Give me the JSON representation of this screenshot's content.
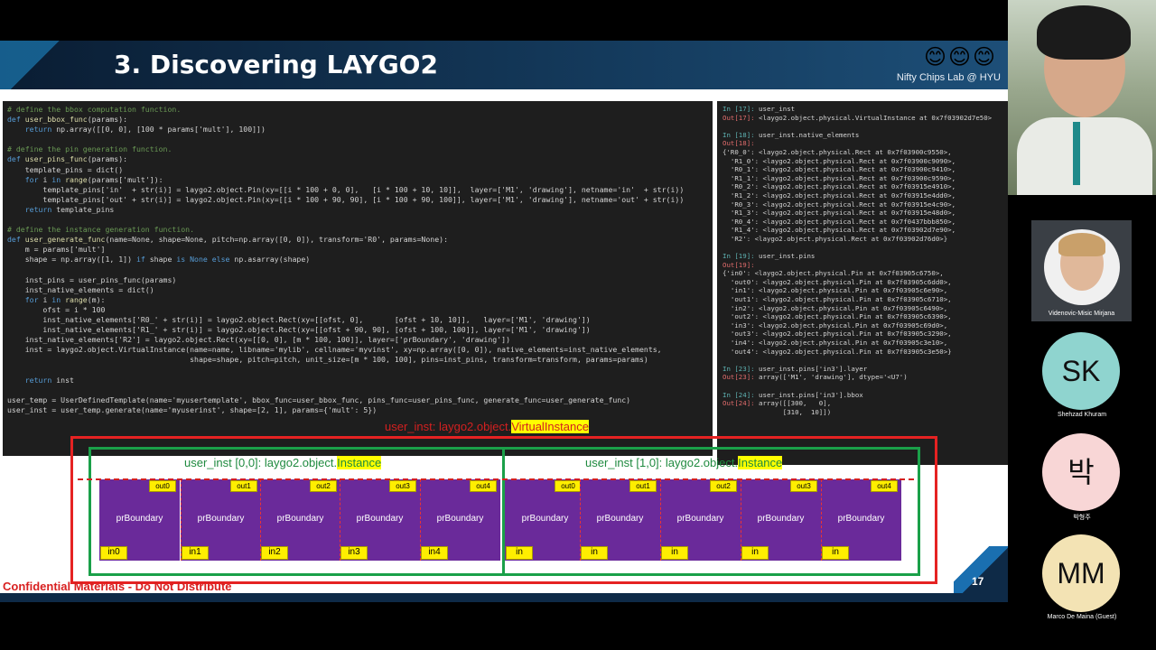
{
  "slide": {
    "title": "3. Discovering LAYGO2",
    "emojis": "😊😊😊",
    "lab_name": "Nifty Chips Lab @ HYU",
    "page_number": "17",
    "confidential": "Confidential Materials - Do Not Distribute"
  },
  "code_left": [
    [
      [
        "cm",
        "# define the bbox computation function."
      ]
    ],
    [
      [
        "kw",
        "def "
      ],
      [
        "fn",
        "user_bbox_func"
      ],
      [
        "",
        "(params):"
      ]
    ],
    [
      [
        "",
        "    "
      ],
      [
        "kw",
        "return "
      ],
      [
        "",
        "np.array([[0, 0], [100 * params['mult'], 100]])"
      ]
    ],
    [
      [
        "",
        ""
      ]
    ],
    [
      [
        "cm",
        "# define the pin generation function."
      ]
    ],
    [
      [
        "kw",
        "def "
      ],
      [
        "fn",
        "user_pins_func"
      ],
      [
        "",
        "(params):"
      ]
    ],
    [
      [
        "",
        "    template_pins = dict()"
      ]
    ],
    [
      [
        "",
        "    "
      ],
      [
        "kw",
        "for "
      ],
      [
        "",
        "i "
      ],
      [
        "kw",
        "in "
      ],
      [
        "fn",
        "range"
      ],
      [
        "",
        "(params['mult']):"
      ]
    ],
    [
      [
        "",
        "        template_pins['in'  + str(i)] = laygo2.object.Pin(xy=[[i * 100 + 0, 0],   [i * 100 + 10, 10]],  layer=['M1', 'drawing'], netname='in'  + str(i))"
      ]
    ],
    [
      [
        "",
        "        template_pins['out' + str(i)] = laygo2.object.Pin(xy=[[i * 100 + 90, 90], [i * 100 + 90, 100]], layer=['M1', 'drawing'], netname='out' + str(i))"
      ]
    ],
    [
      [
        "",
        "    "
      ],
      [
        "kw",
        "return "
      ],
      [
        "",
        "template_pins"
      ]
    ],
    [
      [
        "",
        ""
      ]
    ],
    [
      [
        "cm",
        "# define the instance generation function."
      ]
    ],
    [
      [
        "kw",
        "def "
      ],
      [
        "fn",
        "user_generate_func"
      ],
      [
        "",
        "(name=None, shape=None, pitch=np.array([0, 0]), transform='R0', params=None):"
      ]
    ],
    [
      [
        "",
        "    m = params['mult']"
      ]
    ],
    [
      [
        "",
        "    shape = np.array([1, 1]) "
      ],
      [
        "kw",
        "if "
      ],
      [
        "",
        "shape "
      ],
      [
        "kw",
        "is None else "
      ],
      [
        "",
        "np.asarray(shape)"
      ]
    ],
    [
      [
        "",
        ""
      ]
    ],
    [
      [
        "",
        "    inst_pins = user_pins_func(params)"
      ]
    ],
    [
      [
        "",
        "    inst_native_elements = dict()"
      ]
    ],
    [
      [
        "",
        "    "
      ],
      [
        "kw",
        "for "
      ],
      [
        "",
        "i "
      ],
      [
        "kw",
        "in "
      ],
      [
        "fn",
        "range"
      ],
      [
        "",
        "(m):"
      ]
    ],
    [
      [
        "",
        "        ofst = i * 100"
      ]
    ],
    [
      [
        "",
        "        inst_native_elements['R0_' + str(i)] = laygo2.object.Rect(xy=[[ofst, 0],       [ofst + 10, 10]],   layer=['M1', 'drawing'])"
      ]
    ],
    [
      [
        "",
        "        inst_native_elements['R1_' + str(i)] = laygo2.object.Rect(xy=[[ofst + 90, 90], [ofst + 100, 100]], layer=['M1', 'drawing'])"
      ]
    ],
    [
      [
        "",
        "    inst_native_elements['R2'] = laygo2.object.Rect(xy=[[0, 0], [m * 100, 100]], layer=['prBoundary', 'drawing'])"
      ]
    ],
    [
      [
        "",
        "    inst = laygo2.object.VirtualInstance(name=name, libname='mylib', cellname='myvinst', xy=np.array([0, 0]), native_elements=inst_native_elements,"
      ]
    ],
    [
      [
        "",
        "                                         shape=shape, pitch=pitch, unit_size=[m * 100, 100], pins=inst_pins, transform=transform, params=params)"
      ]
    ],
    [
      [
        "",
        ""
      ]
    ],
    [
      [
        "",
        "    "
      ],
      [
        "kw",
        "return "
      ],
      [
        "",
        "inst"
      ]
    ],
    [
      [
        "",
        ""
      ]
    ],
    [
      [
        "",
        "user_temp = UserDefinedTemplate(name='myusertemplate', bbox_func=user_bbox_func, pins_func=user_pins_func, generate_func=user_generate_func)"
      ]
    ],
    [
      [
        "",
        "user_inst = user_temp.generate(name='myuserinst', shape=[2, 1], params={'mult': 5})"
      ]
    ]
  ],
  "code_right": [
    [
      [
        "pin",
        "In [17]: "
      ],
      [
        "",
        "user_inst"
      ]
    ],
    [
      [
        "outp",
        "Out[17]: "
      ],
      [
        "",
        "<laygo2.object.physical.VirtualInstance at 0x7f03902d7e50>"
      ]
    ],
    [
      [
        "",
        ""
      ]
    ],
    [
      [
        "pin",
        "In [18]: "
      ],
      [
        "",
        "user_inst.native_elements"
      ]
    ],
    [
      [
        "outp",
        "Out[18]:"
      ]
    ],
    [
      [
        "",
        "{'R0_0': <laygo2.object.physical.Rect at 0x7f03900c9550>,"
      ]
    ],
    [
      [
        "",
        "  'R1_0': <laygo2.object.physical.Rect at 0x7f03900c9090>,"
      ]
    ],
    [
      [
        "",
        "  'R0_1': <laygo2.object.physical.Rect at 0x7f03900c9410>,"
      ]
    ],
    [
      [
        "",
        "  'R1_1': <laygo2.object.physical.Rect at 0x7f03900c9590>,"
      ]
    ],
    [
      [
        "",
        "  'R0_2': <laygo2.object.physical.Rect at 0x7f03915e4910>,"
      ]
    ],
    [
      [
        "",
        "  'R1_2': <laygo2.object.physical.Rect at 0x7f03915e4dd0>,"
      ]
    ],
    [
      [
        "",
        "  'R0_3': <laygo2.object.physical.Rect at 0x7f03915e4c90>,"
      ]
    ],
    [
      [
        "",
        "  'R1_3': <laygo2.object.physical.Rect at 0x7f03915e48d0>,"
      ]
    ],
    [
      [
        "",
        "  'R0_4': <laygo2.object.physical.Rect at 0x7f0437bbb850>,"
      ]
    ],
    [
      [
        "",
        "  'R1_4': <laygo2.object.physical.Rect at 0x7f03902d7e90>,"
      ]
    ],
    [
      [
        "",
        "  'R2': <laygo2.object.physical.Rect at 0x7f03902d76d0>}"
      ]
    ],
    [
      [
        "",
        ""
      ]
    ],
    [
      [
        "pin",
        "In [19]: "
      ],
      [
        "",
        "user_inst.pins"
      ]
    ],
    [
      [
        "outp",
        "Out[19]:"
      ]
    ],
    [
      [
        "",
        "{'in0': <laygo2.object.physical.Pin at 0x7f03905c6750>,"
      ]
    ],
    [
      [
        "",
        "  'out0': <laygo2.object.physical.Pin at 0x7f03905c6dd0>,"
      ]
    ],
    [
      [
        "",
        "  'in1': <laygo2.object.physical.Pin at 0x7f03905c6e90>,"
      ]
    ],
    [
      [
        "",
        "  'out1': <laygo2.object.physical.Pin at 0x7f03905c6710>,"
      ]
    ],
    [
      [
        "",
        "  'in2': <laygo2.object.physical.Pin at 0x7f03905c6490>,"
      ]
    ],
    [
      [
        "",
        "  'out2': <laygo2.object.physical.Pin at 0x7f03905c6390>,"
      ]
    ],
    [
      [
        "",
        "  'in3': <laygo2.object.physical.Pin at 0x7f03905c69d0>,"
      ]
    ],
    [
      [
        "",
        "  'out3': <laygo2.object.physical.Pin at 0x7f03905c3290>,"
      ]
    ],
    [
      [
        "",
        "  'in4': <laygo2.object.physical.Pin at 0x7f03905c3e10>,"
      ]
    ],
    [
      [
        "",
        "  'out4': <laygo2.object.physical.Pin at 0x7f03905c3e50>}"
      ]
    ],
    [
      [
        "",
        ""
      ]
    ],
    [
      [
        "pin",
        "In [23]: "
      ],
      [
        "",
        "user_inst.pins['in3'].layer"
      ]
    ],
    [
      [
        "outp",
        "Out[23]: "
      ],
      [
        "",
        "array(['M1', 'drawing'], dtype='<U7')"
      ]
    ],
    [
      [
        "",
        ""
      ]
    ],
    [
      [
        "pin",
        "In [24]: "
      ],
      [
        "",
        "user_inst.pins['in3'].bbox"
      ]
    ],
    [
      [
        "outp",
        "Out[24]: "
      ],
      [
        "",
        "array([[300,   0],"
      ]
    ],
    [
      [
        "",
        "               [310,  10]])"
      ]
    ]
  ],
  "diagram": {
    "virtual_label_prefix": "user_inst: laygo2.object.",
    "virtual_label_hl": "VirtualInstance",
    "inst0_prefix": "user_inst [0,0]: laygo2.object.",
    "inst1_prefix": "user_inst [1,0]: laygo2.object.",
    "inst_hl": "Instance",
    "cell_label": "prBoundary",
    "inst0_in_pins": [
      "in0",
      "in1",
      "in2",
      "in3",
      "in4"
    ],
    "inst1_in_pins": [
      "in",
      "in",
      "in",
      "in",
      "in"
    ],
    "out_pins": [
      "out0",
      "out1",
      "out2",
      "out3",
      "out4"
    ]
  },
  "participants": {
    "tile_v_name": "Videnovic-Misic Mirjana",
    "avatars": [
      {
        "initials": "SK",
        "name": "Shehzad Khuram",
        "color": "#8fd4cf"
      },
      {
        "initials": "박",
        "name": "박형주",
        "color": "#f8d6d6"
      },
      {
        "initials": "MM",
        "name": "Marco De Maina (Guest)",
        "color": "#f3e3b4"
      }
    ]
  }
}
